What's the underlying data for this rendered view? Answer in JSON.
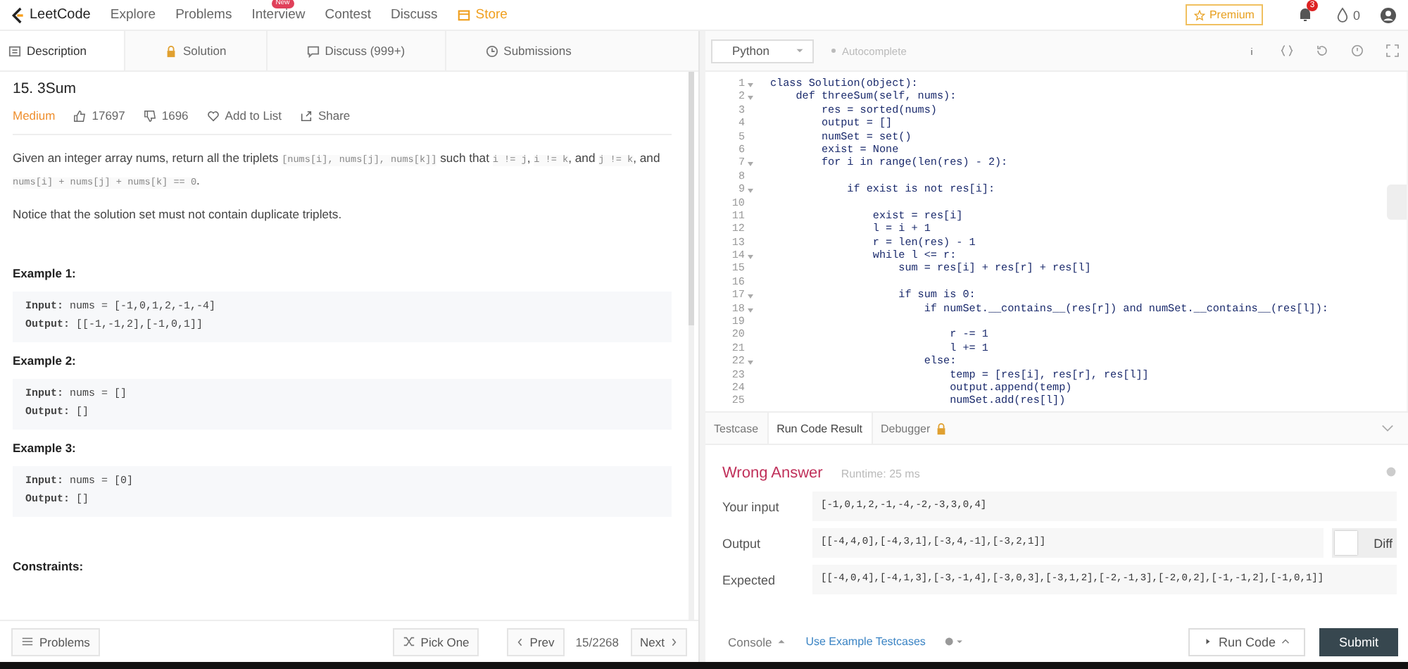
{
  "nav": {
    "brand": "LeetCode",
    "items": [
      {
        "label": "Explore"
      },
      {
        "label": "Problems"
      },
      {
        "label": "Interview",
        "badge": "New"
      },
      {
        "label": "Contest"
      },
      {
        "label": "Discuss"
      }
    ],
    "store": "Store",
    "premium": "Premium",
    "notifications": "3",
    "coins": "0"
  },
  "tabs": [
    {
      "label": "Description",
      "selected": true
    },
    {
      "label": "Solution",
      "selected": false
    },
    {
      "label": "Discuss (999+)",
      "selected": false
    },
    {
      "label": "Submissions",
      "selected": false
    }
  ],
  "problem": {
    "title": "15. 3Sum",
    "difficulty": "Medium",
    "likes": "17697",
    "dislikes": "1696",
    "add_to_list": "Add to List",
    "share": "Share",
    "paragraphs": [
      [
        {
          "kind": "text",
          "text": "Given an integer array nums, return all the triplets "
        },
        {
          "kind": "code",
          "text": "[nums[i], nums[j], nums[k]]"
        },
        {
          "kind": "text",
          "text": " such that "
        },
        {
          "kind": "code",
          "text": "i != j"
        },
        {
          "kind": "text",
          "text": ", "
        },
        {
          "kind": "code",
          "text": "i != k"
        },
        {
          "kind": "text",
          "text": ", and "
        },
        {
          "kind": "code",
          "text": "j != k"
        },
        {
          "kind": "text",
          "text": ", and "
        },
        {
          "kind": "code",
          "text": "nums[i] + nums[j] + nums[k] == 0"
        },
        {
          "kind": "text",
          "text": "."
        }
      ],
      [
        {
          "kind": "text",
          "text": "Notice that the solution set must not contain duplicate triplets."
        }
      ]
    ],
    "examples": [
      {
        "title": "Example 1:",
        "lines": [
          "**Input:** nums = [-1,0,1,2,-1,-4]",
          "**Output:** [[-1,-1,2],[-1,0,1]]"
        ]
      },
      {
        "title": "Example 2:",
        "lines": [
          "**Input:** nums = []",
          "**Output:** []"
        ]
      },
      {
        "title": "Example 3:",
        "lines": [
          "**Input:** nums = [0]",
          "**Output:** []"
        ]
      }
    ],
    "constraints_title": "Constraints:"
  },
  "footer": {
    "problems": "Problems",
    "pick_one": "Pick One",
    "prev": "Prev",
    "page": "15/2268",
    "next": "Next"
  },
  "editor": {
    "language": "Python",
    "autocomplete": "Autocomplete",
    "lines": [
      {
        "n": "1",
        "fold": true,
        "code": "class Solution(object):"
      },
      {
        "n": "2",
        "fold": true,
        "code": "    def threeSum(self, nums):"
      },
      {
        "n": "3",
        "fold": false,
        "code": "        res = sorted(nums)"
      },
      {
        "n": "4",
        "fold": false,
        "code": "        output = []"
      },
      {
        "n": "5",
        "fold": false,
        "code": "        numSet = set()"
      },
      {
        "n": "6",
        "fold": false,
        "code": "        exist = None"
      },
      {
        "n": "7",
        "fold": true,
        "code": "        for i in range(len(res) - 2):"
      },
      {
        "n": "8",
        "fold": false
      },
      {
        "n": "9",
        "fold": true,
        "code": "            if exist is not res[i]:"
      },
      {
        "n": "10",
        "fold": false
      },
      {
        "n": "11",
        "fold": false,
        "code": "                exist = res[i]"
      },
      {
        "n": "12",
        "fold": false,
        "code": "                l = i + 1"
      },
      {
        "n": "13",
        "fold": false,
        "code": "                r = len(res) - 1"
      },
      {
        "n": "14",
        "fold": true,
        "code": "                while l <= r:"
      },
      {
        "n": "15",
        "fold": false,
        "code": "                    sum = res[i] + res[r] + res[l]"
      },
      {
        "n": "16",
        "fold": false
      },
      {
        "n": "17",
        "fold": true,
        "code": "                    if sum is 0:"
      },
      {
        "n": "18",
        "fold": true,
        "code": "                        if numSet.__contains__(res[r]) and numSet.__contains__(res[l]):"
      },
      {
        "n": "19",
        "fold": false
      },
      {
        "n": "20",
        "fold": false,
        "code": "                            r -= 1"
      },
      {
        "n": "21",
        "fold": false,
        "code": "                            l += 1"
      },
      {
        "n": "22",
        "fold": true,
        "code": "                        else:"
      },
      {
        "n": "23",
        "fold": false,
        "code": "                            temp = [res[i], res[r], res[l]]"
      },
      {
        "n": "24",
        "fold": false,
        "code": "                            output.append(temp)"
      },
      {
        "n": "25",
        "fold": false,
        "code": "                            numSet.add(res[l])"
      }
    ]
  },
  "console_tabs": [
    {
      "label": "Testcase",
      "selected": false,
      "locked": false
    },
    {
      "label": "Run Code Result",
      "selected": true,
      "locked": false
    },
    {
      "label": "Debugger",
      "selected": false,
      "locked": true
    }
  ],
  "result": {
    "verdict": "Wrong Answer",
    "runtime": "Runtime: 25 ms",
    "rows": [
      {
        "label": "Your input",
        "value": "[-1,0,1,2,-1,-4,-2,-3,3,0,4]",
        "diff": false
      },
      {
        "label": "Output",
        "value": "[[-4,4,0],[-4,3,1],[-3,4,-1],[-3,2,1]]",
        "diff": true
      },
      {
        "label": "Expected",
        "value": "[[-4,0,4],[-4,1,3],[-3,-1,4],[-3,0,3],[-3,1,2],[-2,-1,3],[-2,0,2],[-1,-1,2],[-1,0,1]]",
        "diff": false
      }
    ],
    "diff_label": "Diff",
    "diff_on": false
  },
  "console_bar": {
    "console": "Console",
    "use_example": "Use Example Testcases",
    "run_code": "Run Code",
    "submit": "Submit"
  }
}
